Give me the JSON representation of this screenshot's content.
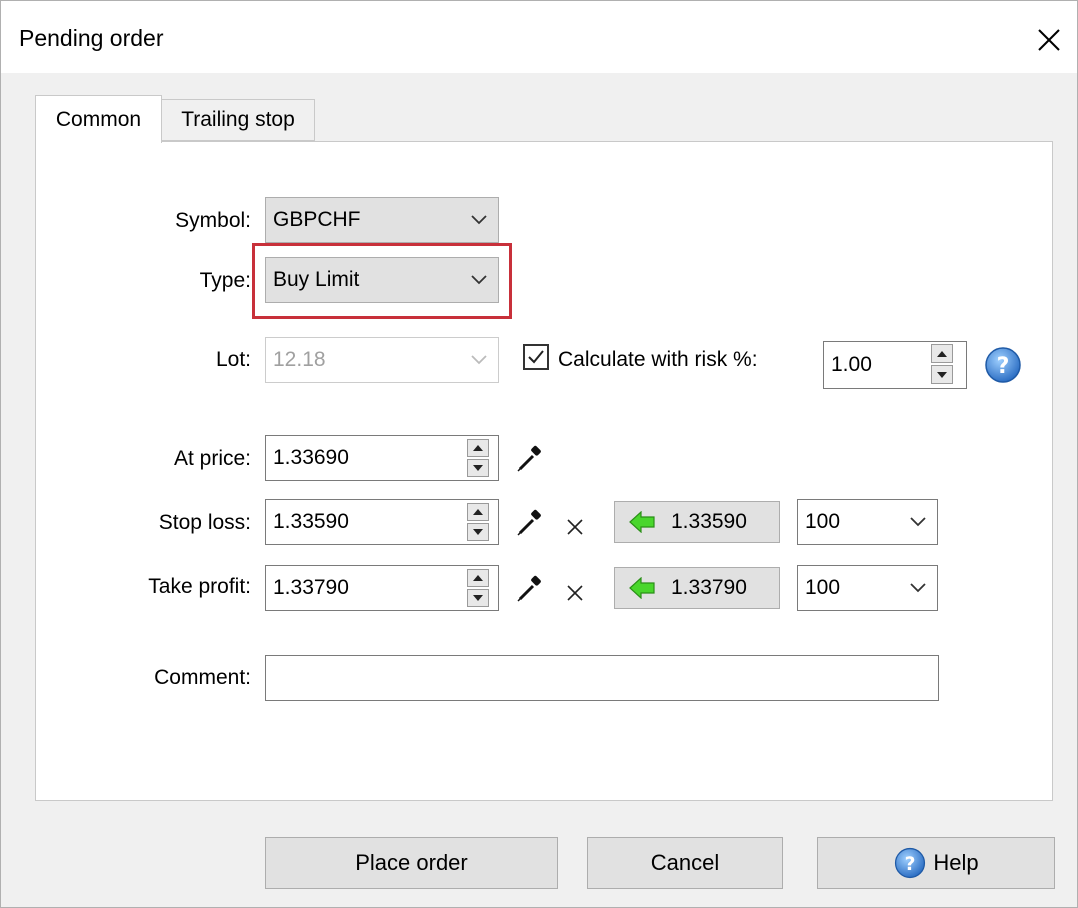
{
  "window": {
    "title": "Pending order"
  },
  "tabs": [
    {
      "label": "Common",
      "active": true
    },
    {
      "label": "Trailing stop",
      "active": false
    }
  ],
  "form": {
    "symbol": {
      "label": "Symbol:",
      "value": "GBPCHF"
    },
    "type": {
      "label": "Type:",
      "value": "Buy Limit"
    },
    "lot": {
      "label": "Lot:",
      "value": "12.18"
    },
    "risk": {
      "label": "Calculate with risk %:",
      "checked": true,
      "value": "1.00"
    },
    "at_price": {
      "label": "At price:",
      "value": "1.33690"
    },
    "stop_loss": {
      "label": "Stop loss:",
      "value": "1.33590",
      "price_button": "1.33590",
      "points": "100"
    },
    "take_profit": {
      "label": "Take profit:",
      "value": "1.33790",
      "price_button": "1.33790",
      "points": "100"
    },
    "comment": {
      "label": "Comment:",
      "value": ""
    }
  },
  "buttons": {
    "place_order": "Place order",
    "cancel": "Cancel",
    "help": "Help"
  },
  "colors": {
    "highlight": "#c8303a",
    "arrow_green": "#49d62c",
    "help_blue": "#3a7fd6"
  },
  "icons": [
    "close-icon",
    "chevron-down-icon",
    "help-icon",
    "eyedropper-icon",
    "clear-x-icon",
    "left-arrow-icon",
    "spin-up-icon",
    "spin-down-icon",
    "checkmark-icon"
  ]
}
